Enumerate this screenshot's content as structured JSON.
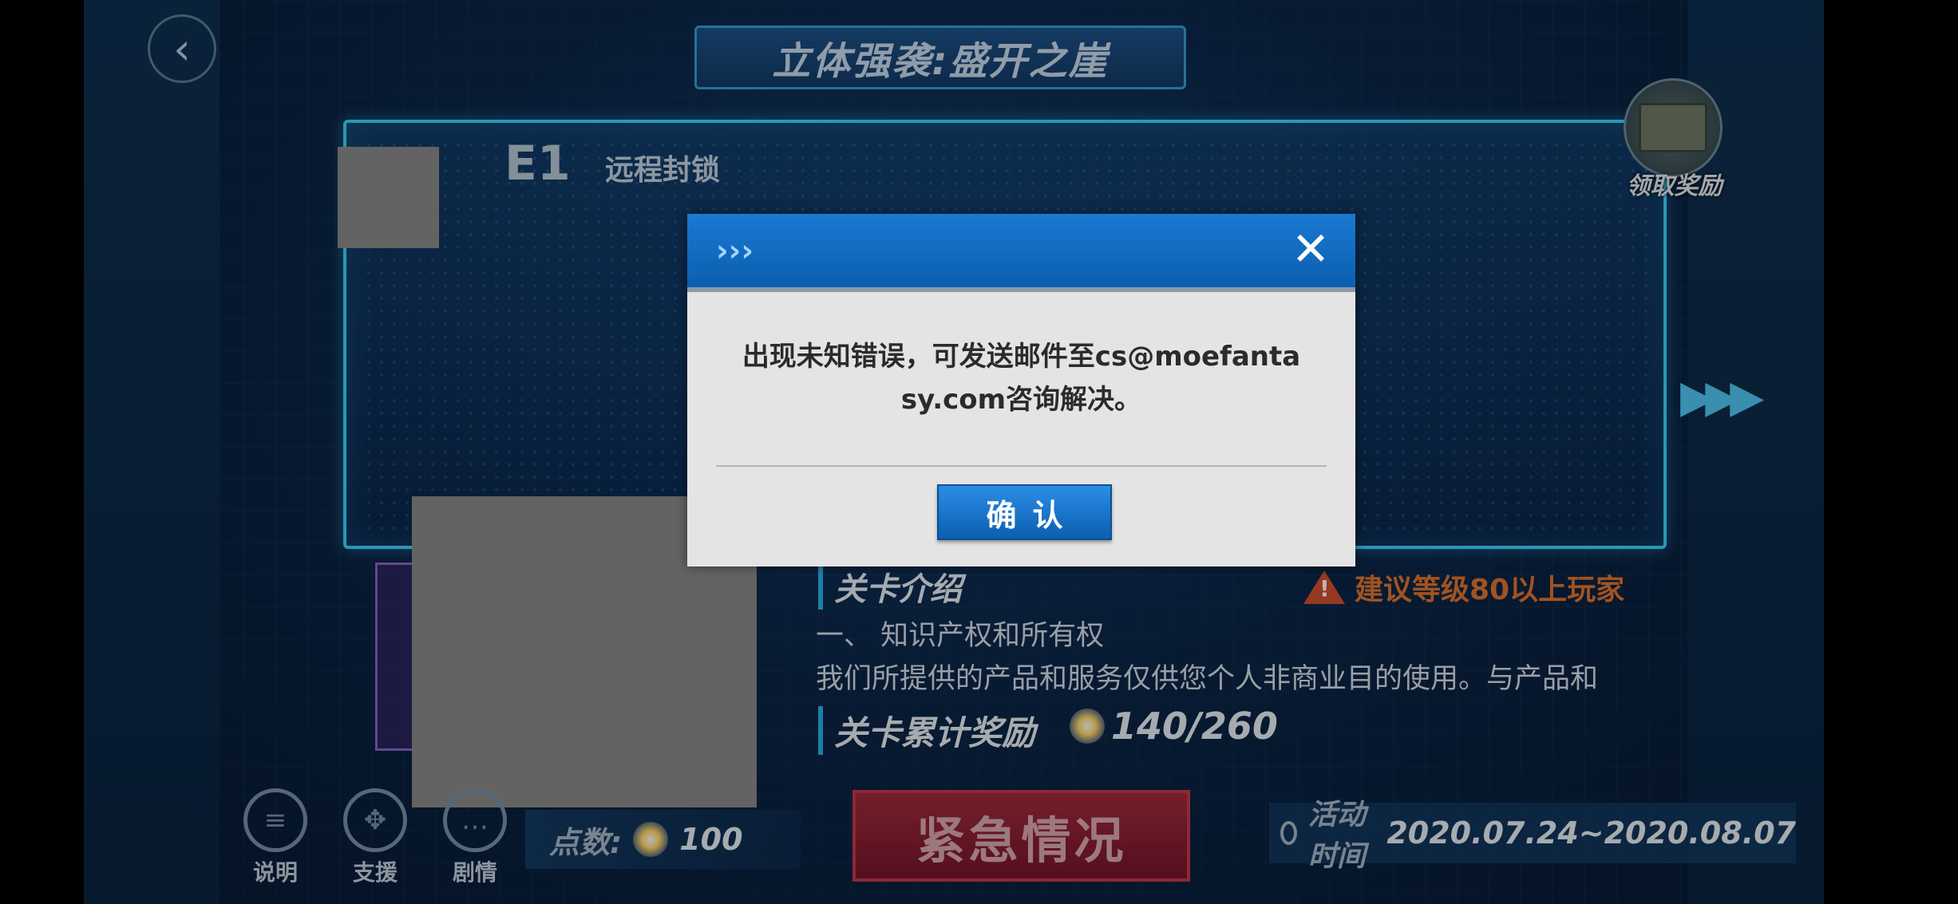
{
  "header": {
    "back_icon": "chevron-left-icon",
    "title": "立体强袭:盛开之崖"
  },
  "reward_chest": {
    "icon": "treasure-chest-icon",
    "label": "领取奖励"
  },
  "stage": {
    "code": "E1",
    "name": "远程封锁"
  },
  "intro": {
    "section_title": "关卡介绍",
    "warning_icon": "warning-triangle-icon",
    "warning_text": "建议等级80以上玩家",
    "line1": "一、 知识产权和所有权",
    "line2": "我们所提供的产品和服务仅供您个人非商业目的使用。与产品和"
  },
  "rewards": {
    "title": "关卡累计奖励",
    "progress": "140/260"
  },
  "bottom_bar": {
    "buttons": [
      {
        "label": "说明",
        "icon": "document-icon"
      },
      {
        "label": "支援",
        "icon": "support-icon"
      },
      {
        "label": "剧情",
        "icon": "chat-bubble-icon"
      }
    ],
    "points_label": "点数:",
    "points_value": "100",
    "emergency_button": "紧急情况",
    "activity_label": "活动时间",
    "activity_value": "2020.07.24~2020.08.07"
  },
  "dialog": {
    "header_icon": "chevrons-right-icon",
    "close_icon": "close-icon",
    "message": "出现未知错误，可发送邮件至cs@moefantasy.com咨询解决。",
    "confirm_label": "确认"
  }
}
